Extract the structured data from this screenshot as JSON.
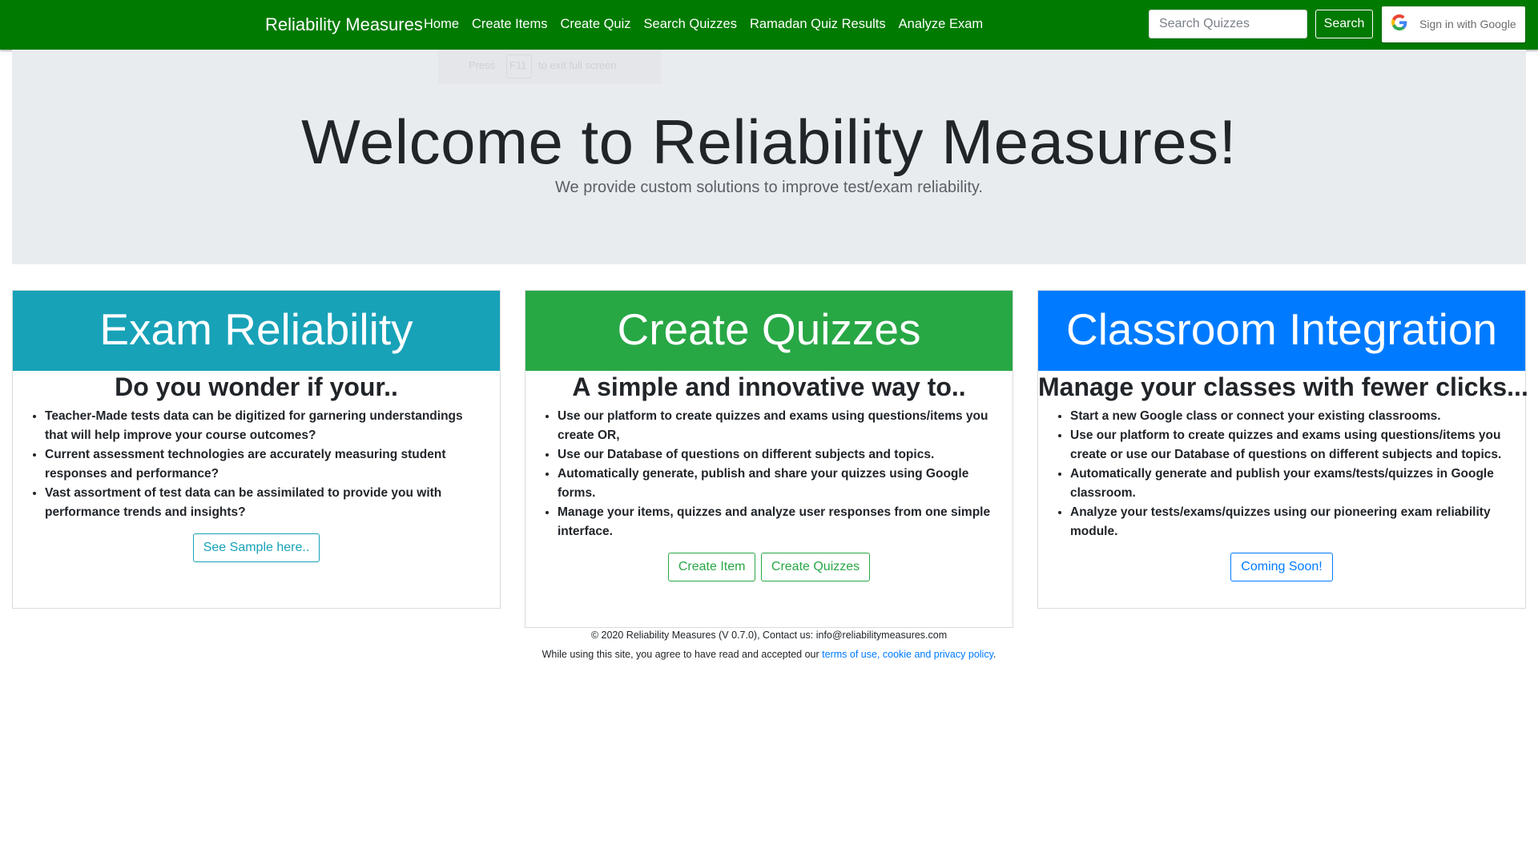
{
  "navbar": {
    "brand": "Reliability Measures",
    "links": [
      "Home",
      "Create Items",
      "Create Quiz",
      "Search Quizzes",
      "Ramadan Quiz Results",
      "Analyze Exam"
    ],
    "search_placeholder": "Search Quizzes",
    "search_button": "Search",
    "google_button": "Sign in with Google",
    "bg_color": "#007a00"
  },
  "fullscreen_hint": {
    "before": "Press",
    "key": "F11",
    "after": "to exit full screen"
  },
  "jumbotron": {
    "title": "Welcome to Reliability Measures!",
    "subtitle": "We provide custom solutions to improve test/exam reliability."
  },
  "cards": [
    {
      "header": "Exam Reliability",
      "header_color": "#17a2b8",
      "heading": "Do you wonder if your..",
      "bullets": [
        "Teacher-Made tests data can be digitized for garnering understandings that will help improve your course outcomes?",
        "Current assessment technologies are accurately measuring student responses and performance?",
        "Vast assortment of test data can be assimilated to provide you with performance trends and insights?"
      ],
      "buttons": [
        "See Sample here.."
      ]
    },
    {
      "header": "Create Quizzes",
      "header_color": "#28a745",
      "heading": "A simple and innovative way to..",
      "bullets": [
        "Use our platform to create quizzes and exams using questions/items you create OR,",
        "Use our Database of questions on different subjects and topics.",
        "Automatically generate, publish and share your quizzes using Google forms.",
        "Manage your items, quizzes and analyze user responses from one simple interface."
      ],
      "buttons": [
        "Create Item",
        "Create Quizzes"
      ]
    },
    {
      "header": "Classroom Integration",
      "header_color": "#007bff",
      "heading": "Manage your classes with fewer clicks...",
      "bullets": [
        "Start a new Google class or connect your existing classrooms.",
        "Use our platform to create quizzes and exams using questions/items you create or use our Database of questions on different subjects and topics.",
        "Automatically generate and publish your exams/tests/quizzes in Google classroom.",
        "Analyze your tests/exams/quizzes using our pioneering exam reliability module."
      ],
      "buttons": [
        "Coming Soon!"
      ]
    }
  ],
  "footer": {
    "line1": "© 2020 Reliability Measures (V 0.7.0), Contact us: info@reliabilitymeasures.com",
    "line2_prefix": "While using this site, you agree to have read and accepted our ",
    "line2_link": "terms of use, cookie and privacy policy",
    "line2_suffix": "."
  }
}
